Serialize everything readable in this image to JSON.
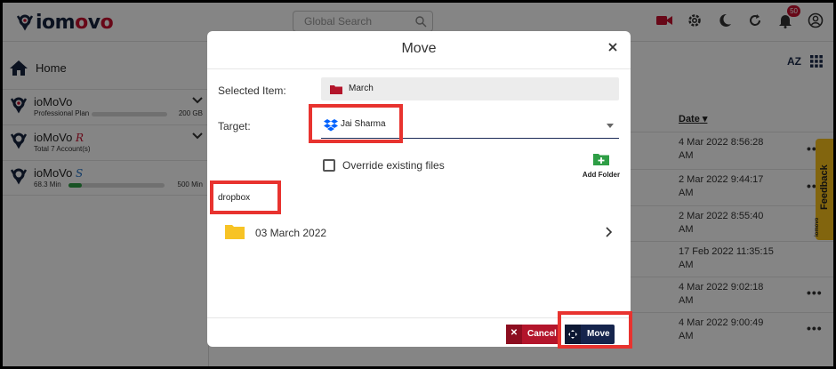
{
  "header": {
    "logo_prefix": "io",
    "logo_m": "m",
    "logo_o1": "o",
    "logo_v": "v",
    "logo_o2": "o",
    "search_placeholder": "Global Search",
    "notification_count": "50"
  },
  "sidebar": {
    "home_label": "Home",
    "items": [
      {
        "name": "ioMoVo",
        "suffix": "",
        "sub": "Professional Plan",
        "value": "200 GB",
        "progress": 0.0,
        "has_chevron": true
      },
      {
        "name": "ioMoVo",
        "suffix": "R",
        "sub": "Total 7 Account(s)",
        "value": "",
        "has_chevron": true
      },
      {
        "name": "ioMoVo",
        "suffix": "S",
        "sub": "68.3 Min",
        "value": "500 Min",
        "progress": 0.14,
        "has_chevron": false
      }
    ]
  },
  "main": {
    "sort_label": "AZ",
    "date_header": "Date",
    "rows": [
      {
        "date": "4 Mar 2022 8:56:28 AM"
      },
      {
        "date": "2 Mar 2022 9:44:17 AM"
      },
      {
        "date": "2 Mar 2022 8:55:40 AM"
      },
      {
        "date": "17 Feb 2022 11:35:15 AM"
      },
      {
        "date": "4 Mar 2022 9:02:18 AM"
      },
      {
        "date": "4 Mar 2022 9:00:49 AM"
      }
    ],
    "feedback_label": "Feedback",
    "feedback_logo": "iomovo"
  },
  "modal": {
    "title": "Move",
    "selected_item_label": "Selected Item:",
    "selected_item_value": "March",
    "target_label": "Target:",
    "target_value": "Jai Sharma",
    "override_label": "Override existing files",
    "override_checked": false,
    "add_folder_label": "Add Folder",
    "storage_label": "dropbox",
    "folders": [
      {
        "name": "03 March 2022"
      }
    ],
    "cancel_label": "Cancel",
    "move_label": "Move"
  },
  "colors": {
    "brand_navy": "#15244c",
    "brand_red": "#c8102e",
    "highlight": "#e8332f",
    "folder_yellow": "#f7c325",
    "feedback_yellow": "#f9c21b"
  }
}
